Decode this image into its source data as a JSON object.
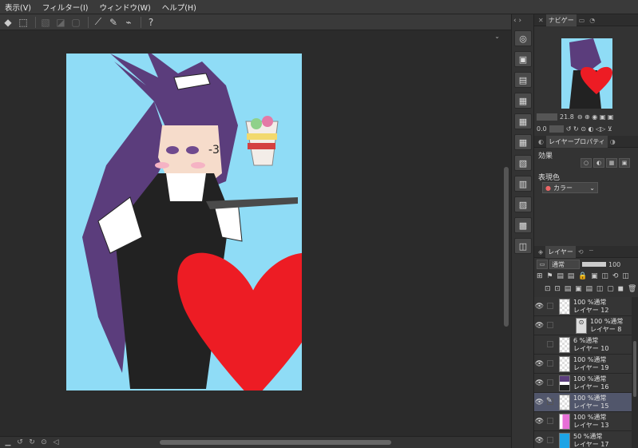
{
  "menu": [
    "表示(V)",
    "フィルター(I)",
    "ウィンドウ(W)",
    "ヘルプ(H)"
  ],
  "toolbar_icons": [
    "fill-icon",
    "select-icon",
    "pen-tool-icon",
    "gradient-icon",
    "stamp-icon",
    "ruler-icon",
    "brush-stroke-icon",
    "correct-line-icon",
    "help-icon"
  ],
  "navigator": {
    "tab_label": "ナビゲー",
    "zoom_value": "21.8",
    "rotation_value": "0.0"
  },
  "layer_property": {
    "tab_label": "レイヤープロパティ",
    "effect_label": "効果",
    "color_label": "表現色",
    "color_value": "カラー"
  },
  "layers_panel": {
    "tab_label": "レイヤー",
    "blend_mode": "通常",
    "opacity": "100",
    "layers": [
      {
        "line1": "100 %通常",
        "line2": "レイヤー 12",
        "indent": false,
        "selected": false,
        "visible": true,
        "type": "plain",
        "pen": false
      },
      {
        "line1": "100 %通常",
        "line2": "レイヤー 8",
        "indent": true,
        "selected": false,
        "visible": true,
        "type": "icon",
        "pen": false
      },
      {
        "line1": "6 %通常",
        "line2": "レイヤー 10",
        "indent": false,
        "selected": false,
        "visible": false,
        "type": "plain",
        "pen": false
      },
      {
        "line1": "100 %通常",
        "line2": "レイヤー 19",
        "indent": false,
        "selected": false,
        "visible": true,
        "type": "plain",
        "pen": false
      },
      {
        "line1": "100 %通常",
        "line2": "レイヤー 16",
        "indent": false,
        "selected": false,
        "visible": true,
        "type": "figure",
        "pen": false
      },
      {
        "line1": "100 %通常",
        "line2": "レイヤー 15",
        "indent": false,
        "selected": true,
        "visible": true,
        "type": "plain",
        "pen": true
      },
      {
        "line1": "100 %通常",
        "line2": "レイヤー 13",
        "indent": false,
        "selected": false,
        "visible": true,
        "type": "pink",
        "pen": false
      },
      {
        "line1": "50 %通常",
        "line2": "レイヤー 17",
        "indent": false,
        "selected": false,
        "visible": true,
        "type": "blue",
        "pen": false
      }
    ]
  },
  "artwork": {
    "background_color": "#8fdcf6",
    "hair_color": "#5b3d7c",
    "heart_color": "#ed1c24",
    "sketch_text": "-3"
  },
  "colors": {
    "app_bg": "#2b2b2b",
    "panel_bg": "#333333",
    "selected_layer": "#51566b"
  }
}
